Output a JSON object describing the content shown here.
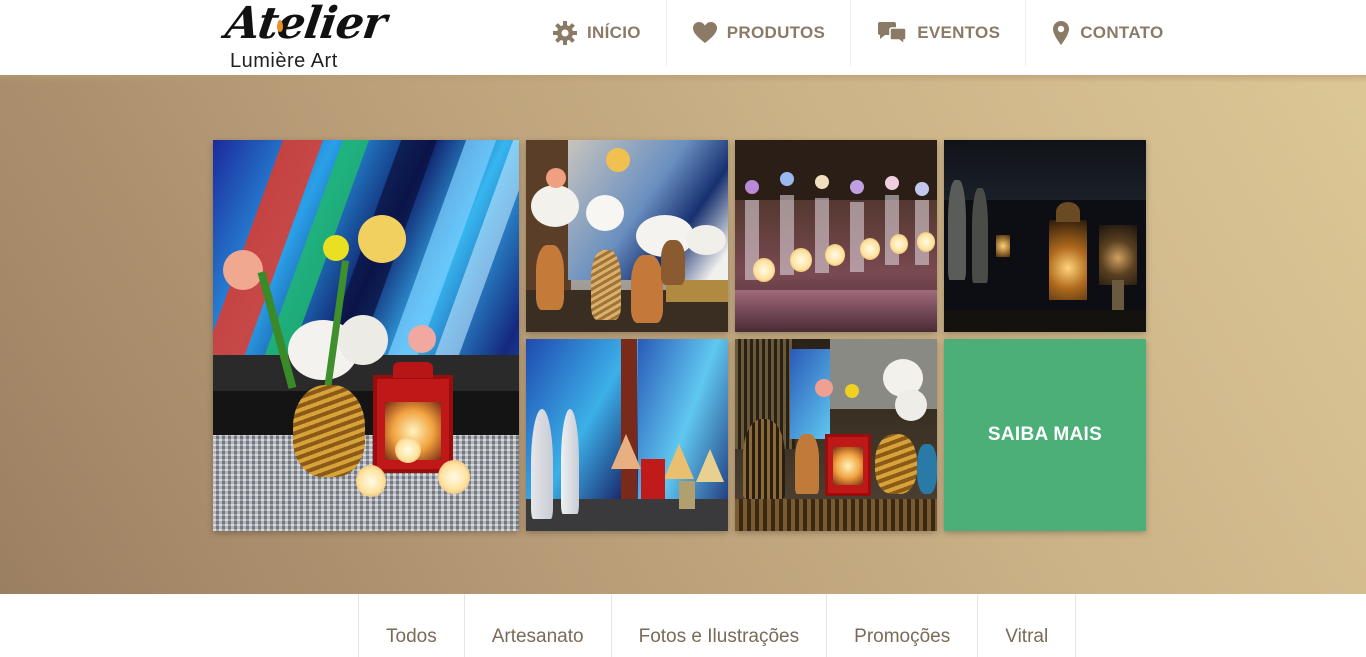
{
  "brand": {
    "script": "Atelier",
    "sub": "Lumière Art"
  },
  "nav": [
    {
      "label": "INÍCIO",
      "icon": "gear-icon"
    },
    {
      "label": "PRODUTOS",
      "icon": "heart-icon"
    },
    {
      "label": "EVENTOS",
      "icon": "chat-bubbles-icon"
    },
    {
      "label": "CONTATO",
      "icon": "map-pin-icon"
    }
  ],
  "gallery": {
    "cta_label": "SAIBA MAIS"
  },
  "categories": [
    "Todos",
    "Artesanato",
    "Fotos e Ilustrações",
    "Promoções",
    "Vitral"
  ],
  "colors": {
    "nav_text": "#8a7a66",
    "cta_bg": "#4caf78",
    "hero_start": "#9b7f61",
    "hero_end": "#dcc796"
  }
}
